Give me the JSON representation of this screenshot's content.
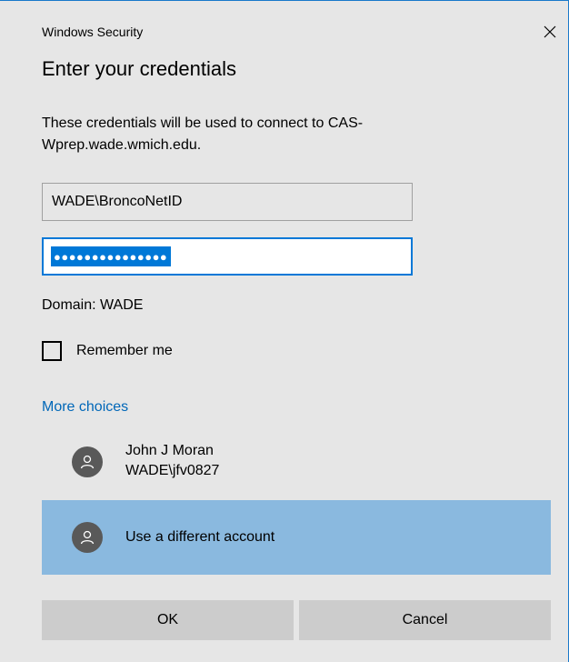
{
  "window": {
    "title": "Windows Security",
    "close_icon": "close-icon"
  },
  "dialog": {
    "heading": "Enter your credentials",
    "message": "These credentials will be used to connect to CAS-Wprep.wade.wmich.edu.",
    "username_value": "WADE\\BroncoNetID",
    "password_masked": "●●●●●●●●●●●●●●●",
    "domain_label": "Domain: WADE",
    "remember_label": "Remember me",
    "remember_checked": false,
    "more_choices_label": "More choices"
  },
  "accounts": [
    {
      "name": "John J Moran",
      "username": "WADE\\jfv0827",
      "icon": "user-icon",
      "selected": false
    },
    {
      "name": "Use a different account",
      "icon": "user-icon",
      "selected": true
    }
  ],
  "buttons": {
    "ok_label": "OK",
    "cancel_label": "Cancel"
  },
  "colors": {
    "accent": "#0078d7",
    "link": "#0067b8",
    "selected_row": "#8ab9df",
    "background": "#e6e6e6"
  }
}
